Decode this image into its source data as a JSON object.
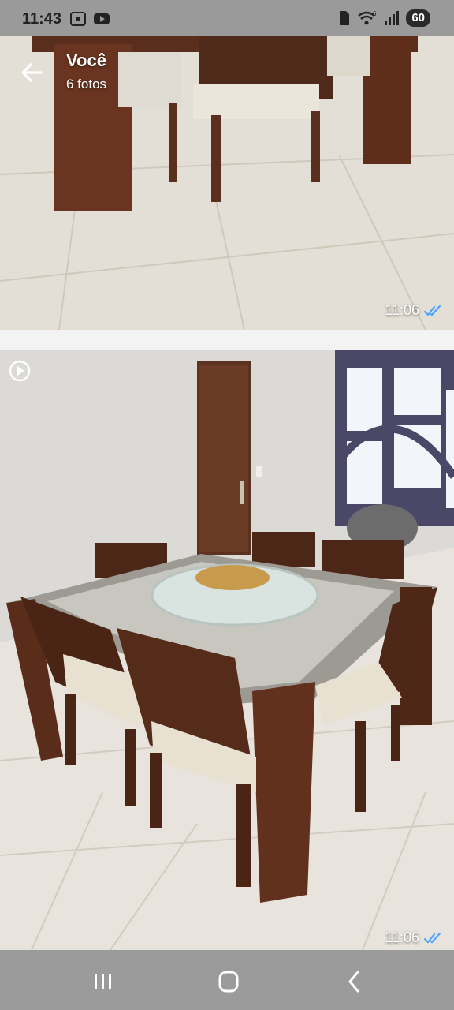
{
  "status": {
    "time": "11:43",
    "battery": "60",
    "wifi_suffix": "6"
  },
  "header": {
    "title": "Você",
    "subtitle": "6 fotos"
  },
  "messages": [
    {
      "time": "11:06"
    },
    {
      "time": "11:06"
    }
  ],
  "icons": {
    "back": "arrow-back-icon",
    "video": "video-play-icon",
    "read": "double-check-icon"
  },
  "colors": {
    "statusbar": "#9a9a9a",
    "navbar": "#9b9b9b",
    "read_check": "#4da3ff"
  }
}
